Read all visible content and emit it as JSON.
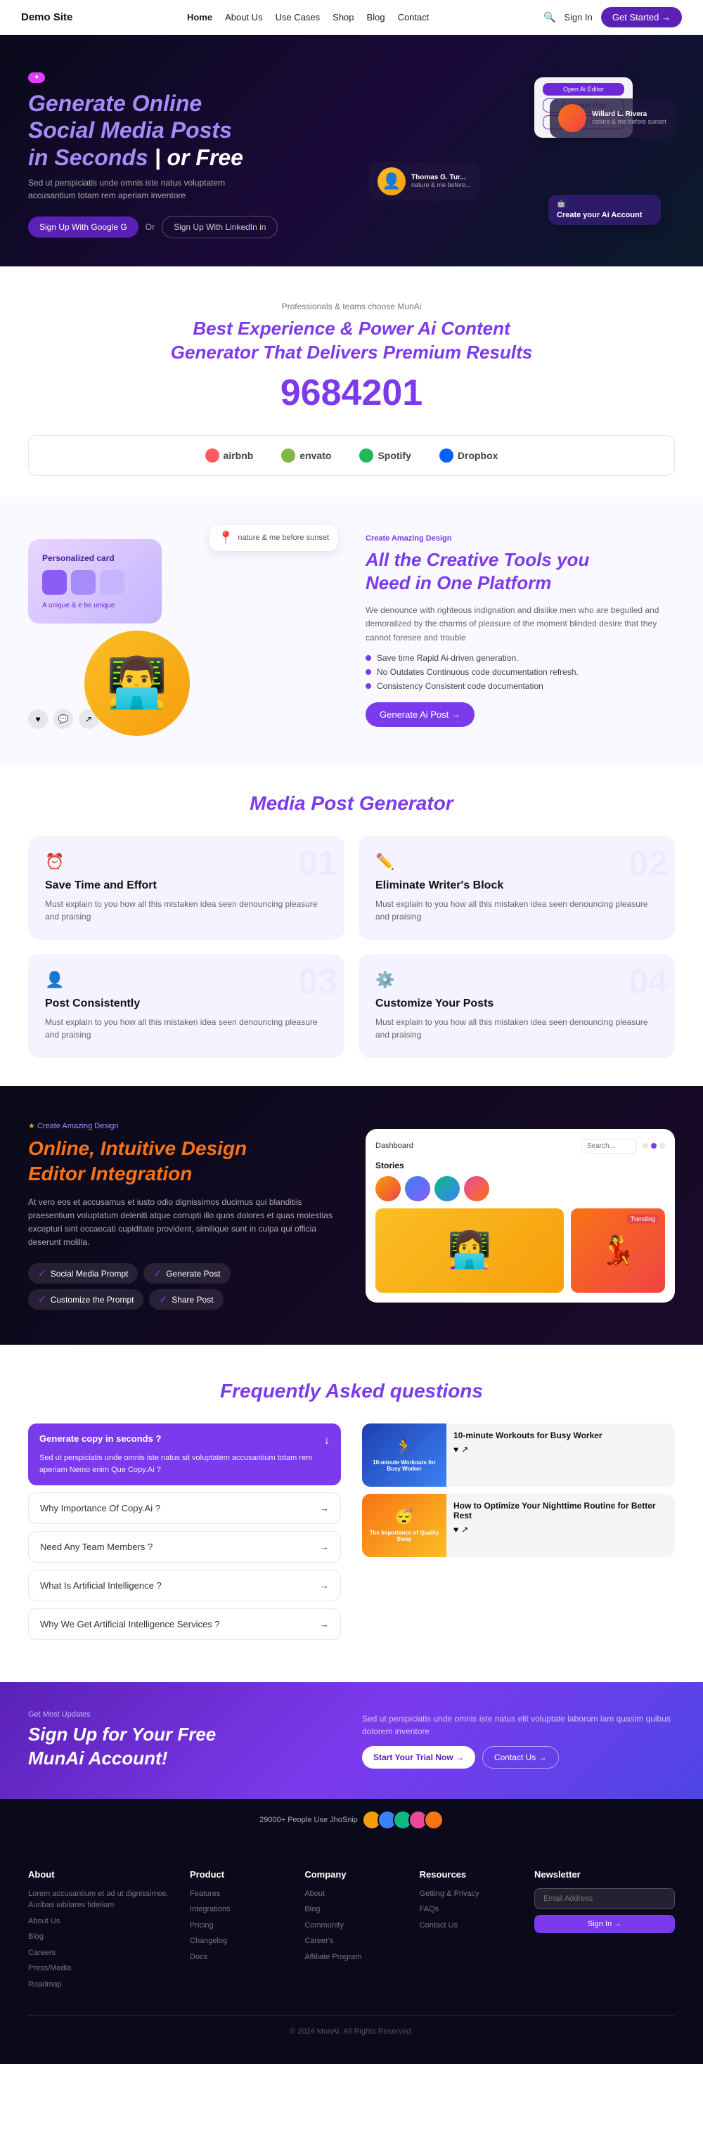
{
  "navbar": {
    "logo": "Demo Site",
    "links": [
      {
        "label": "Home",
        "active": true,
        "dropdown": true
      },
      {
        "label": "About Us",
        "dropdown": true
      },
      {
        "label": "Use Cases",
        "dropdown": true
      },
      {
        "label": "Shop",
        "dropdown": true
      },
      {
        "label": "Blog",
        "dropdown": false
      },
      {
        "label": "Contact",
        "dropdown": false
      }
    ],
    "signin_label": "Sign In",
    "getstarted_label": "Get Started →"
  },
  "hero": {
    "badge": "✦",
    "title_line1": "Generate Online",
    "title_line2": "Social Media Posts",
    "title_line3_part1": "in ",
    "title_line3_italic": "Seconds",
    "title_line3_sep": " | or",
    "title_line3_end": " Free",
    "subtitle": "Sed ut perspiciatis unde omnis iste natus voluptatem accusantium totam rem aperiam inventore",
    "btn_google": "Sign Up With Google G",
    "btn_or": "Or",
    "btn_linkedin": "Sign Up With LinkedIn in",
    "cards": {
      "top": {
        "btn1": "Open Ai Editor",
        "btn2": "Customize Post",
        "btn3": "Download Result"
      },
      "person1": {
        "name": "Willard L. Rivera",
        "sub": "nature & me before sunset"
      },
      "person2": {
        "name": "Thomas G. Tur...",
        "sub": "nature & me before..."
      },
      "bottom": {
        "text": "Create your Ai Account"
      }
    }
  },
  "brands": {
    "subtitle": "Professionals & teams choose MunAi",
    "title_line1": "Best Experience & Power Ai Content",
    "title_line2_regular": "Generator That Delivers ",
    "title_line2_italic": "Premium Results",
    "number": "9684201",
    "logos": [
      {
        "name": "airbnb",
        "label": "airbnb"
      },
      {
        "name": "envato",
        "label": "envato"
      },
      {
        "name": "spotify",
        "label": "Spotify"
      },
      {
        "name": "dropbox",
        "label": "Dropbox"
      }
    ]
  },
  "features": {
    "label": "Create Amazing Design",
    "title_regular": "All the Creative Tools you",
    "title_line2_regular": "Need in ",
    "title_italic": "One Platform",
    "desc": "We denounce with righteous indignation and dislike men who are beguiled and demoralized by the charms of pleasure of the moment blinded desire that they cannot foresee and trouble",
    "checks": [
      "Save time Rapid Ai-driven generation.",
      "No Outdates Continuous code documentation refresh.",
      "Consistency Consistent code documentation"
    ],
    "btn": "Generate Ai Post →",
    "card_label": "Personalized card"
  },
  "media": {
    "title_regular": "Media ",
    "title_italic": "Post Generator",
    "cards": [
      {
        "icon": "⏰",
        "title": "Save Time and Effort",
        "desc": "Must explain to you how all this mistaken idea seen denouncing pleasure and praising",
        "num": "01"
      },
      {
        "icon": "✏️",
        "title": "Eliminate Writer's Block",
        "desc": "Must explain to you how all this mistaken idea seen denouncing pleasure and praising",
        "num": "02"
      },
      {
        "icon": "👤",
        "title": "Post Consistently",
        "desc": "Must explain to you how all this mistaken idea seen denouncing pleasure and praising",
        "num": "03"
      },
      {
        "icon": "⚙️",
        "title": "Customize Your Posts",
        "desc": "Must explain to you how all this mistaken idea seen denouncing pleasure and praising",
        "num": "04"
      }
    ]
  },
  "editor": {
    "badge": "Create Amazing Design",
    "title_line1": "Online, Intuitive Design",
    "title_line2_regular": "Editor ",
    "title_italic": "Integration",
    "desc": "At vero eos et accusamus et iusto odio dignissimos ducimus qui blanditiis praesentium voluptatum deleniti atque corrupti illo quos dolores et quas molestias excepturi sint occaecati cupiditate provident, similique sunt in culpa qui officia deserunt molilla.",
    "tags": [
      "Social Media Prompt",
      "Generate Post",
      "Customize the Prompt",
      "Share Post"
    ],
    "dashboard": {
      "title": "Dashboard",
      "search_placeholder": "Search...",
      "stories_label": "Stories",
      "trending_badge": "Trending"
    }
  },
  "faq": {
    "title_regular": "Frequently Asked ",
    "title_italic": "questions",
    "active_question": "Generate copy in seconds ?",
    "active_answer": "Sed ut perspiciatis unde omnis iste natus sit voluptatem accusantium totam rem aperiam Nemo enim Que Copy.Ai ?",
    "items": [
      {
        "label": "Why Importance Of Copy.Ai ?"
      },
      {
        "label": "Need Any Team Members ?"
      },
      {
        "label": "What Is Artificial Intelligence ?"
      },
      {
        "label": "Why We Get Artificial Intelligence Services ?"
      }
    ],
    "images": [
      {
        "type": "blue",
        "title": "10-minute Workouts for Busy Worker",
        "label": "10-minute Workouts for Busy Worker"
      },
      {
        "type": "orange",
        "title": "The Importance of Quality Sleep",
        "label": "How to Optimize Your Nighttime Routine for Better Rest"
      }
    ]
  },
  "cta": {
    "label": "Get Most Updates",
    "title_line1": "Sign Up for Your Free",
    "title_line2": "MunAi ",
    "title_italic": "Account!",
    "desc": "Sed ut perspiciatis unde omnis iste natus elit voluptate laborum iam quasim quibus dolorem inventore",
    "btn_trial": "Start Your Trial Now →",
    "btn_contact": "Contact Us →"
  },
  "social_proof": {
    "text": "29000+ People Use JhoSnip"
  },
  "footer": {
    "about_title": "About",
    "about_text": "Lorem accusantium et ad ut dignissimos. Auribas iubilares fidelium",
    "about_links": [
      "About Us",
      "Blog",
      "Careers",
      "Press/Media",
      "Roadmap"
    ],
    "product_title": "Product",
    "product_links": [
      "Features",
      "Integrations",
      "Pricing",
      "Changelog",
      "Docs"
    ],
    "company_title": "Company",
    "company_links": [
      "About",
      "Blog",
      "Community",
      "Career's",
      "Affiliate Program"
    ],
    "resources_title": "Resources",
    "resources_links": [
      "Getting & Privacy",
      "FAQs",
      "Contact Us"
    ],
    "newsletter_title": "Newsletter",
    "newsletter_placeholder": "Email Address",
    "newsletter_btn": "Sign In →",
    "footer_bottom": "© 2024 MunAI. All Rights Reserved."
  }
}
